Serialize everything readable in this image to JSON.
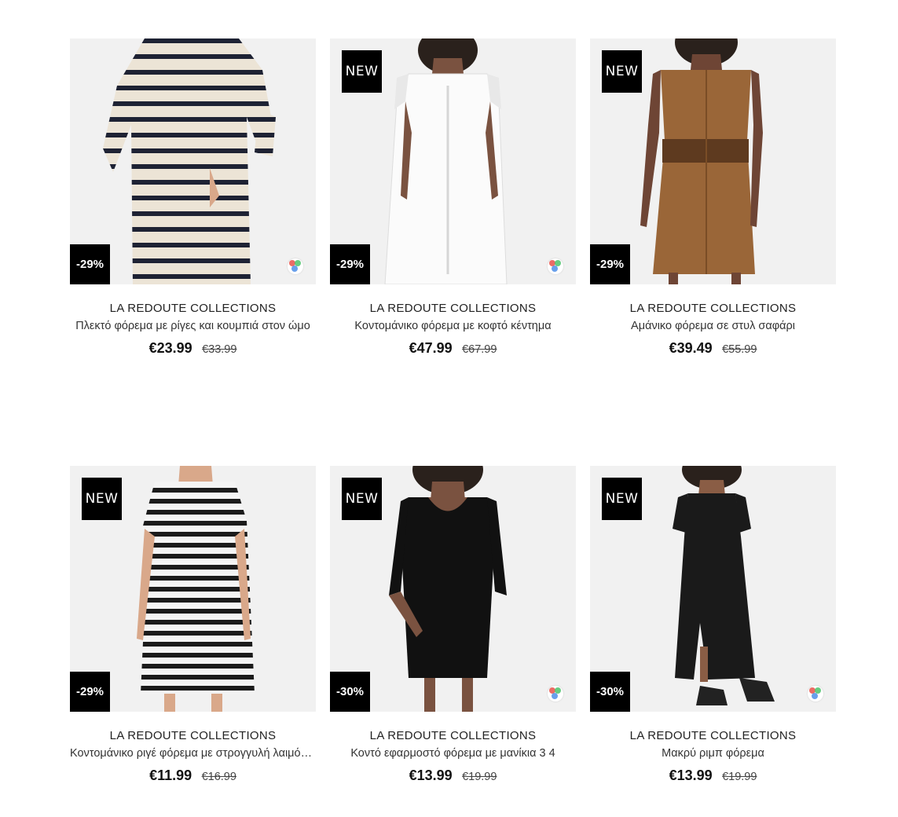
{
  "products": [
    {
      "brand": "LA REDOUTE COLLECTIONS",
      "title": "Πλεκτό φόρεμα με ρίγες και κουμπιά στον ώμο",
      "price": "€23.99",
      "old_price": "€33.99",
      "discount": "-29%",
      "is_new": false,
      "new_label": "",
      "has_colors": true,
      "dress": "striped-knit"
    },
    {
      "brand": "LA REDOUTE COLLECTIONS",
      "title": "Κοντομάνικο φόρεμα με κοφτό κέντημα",
      "price": "€47.99",
      "old_price": "€67.99",
      "discount": "-29%",
      "is_new": true,
      "new_label": "NEW",
      "has_colors": true,
      "dress": "white-lace"
    },
    {
      "brand": "LA REDOUTE COLLECTIONS",
      "title": "Αμάνικο φόρεμα σε στυλ σαφάρι",
      "price": "€39.49",
      "old_price": "€55.99",
      "discount": "-29%",
      "is_new": true,
      "new_label": "NEW",
      "has_colors": false,
      "dress": "brown-safari"
    },
    {
      "brand": "LA REDOUTE COLLECTIONS",
      "title": "Κοντομάνικο ριγέ φόρεμα με στρογγυλή λαιμόκοψη",
      "price": "€11.99",
      "old_price": "€16.99",
      "discount": "-29%",
      "is_new": true,
      "new_label": "NEW",
      "has_colors": false,
      "dress": "striped-tee"
    },
    {
      "brand": "LA REDOUTE COLLECTIONS",
      "title": "Κοντό εφαρμοστό φόρεμα με μανίκια 3 4",
      "price": "€13.99",
      "old_price": "€19.99",
      "discount": "-30%",
      "is_new": true,
      "new_label": "NEW",
      "has_colors": true,
      "dress": "black-fitted"
    },
    {
      "brand": "LA REDOUTE COLLECTIONS",
      "title": "Μακρύ ριμπ φόρεμα",
      "price": "€13.99",
      "old_price": "€19.99",
      "discount": "-30%",
      "is_new": true,
      "new_label": "NEW",
      "has_colors": true,
      "dress": "black-maxi"
    }
  ],
  "colors": {
    "badge_bg": "#000000",
    "image_bg": "#f1f1f1",
    "swatch_red": "#e9524a",
    "swatch_green": "#4cc36b",
    "swatch_blue": "#4f8fe8"
  }
}
